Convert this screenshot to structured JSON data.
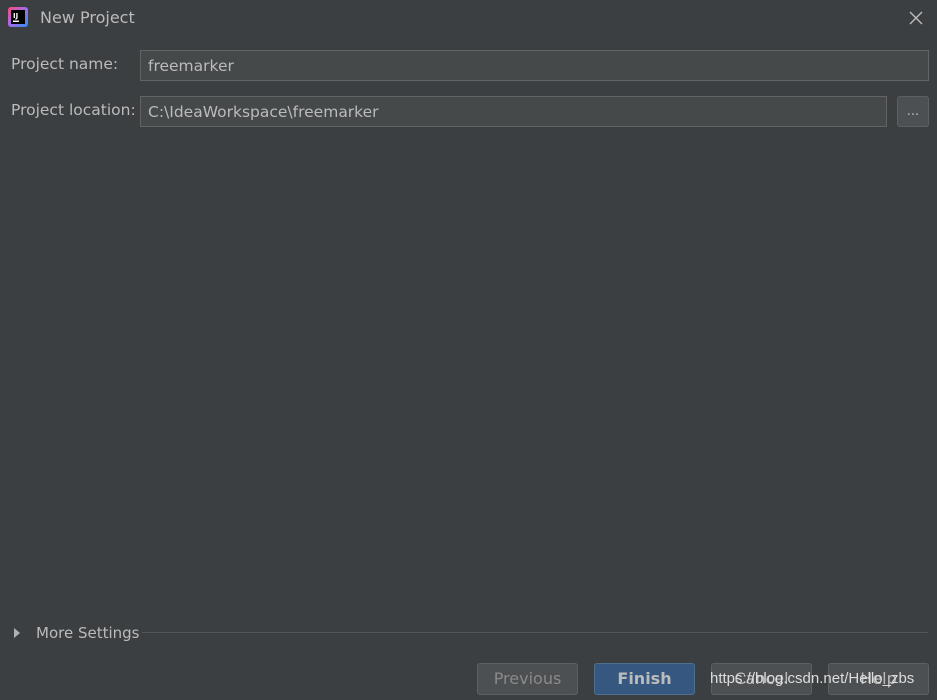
{
  "window": {
    "title": "New Project",
    "app_icon": "intellij-idea-icon",
    "close_icon": "close-icon"
  },
  "form": {
    "project_name_label": "Project name:",
    "project_name_value": "freemarker",
    "project_location_label": "Project location:",
    "project_location_value": "C:\\IdeaWorkspace\\freemarker",
    "browse_label": "..."
  },
  "more_settings": {
    "label": "More Settings",
    "expanded": false,
    "icon": "triangle-right-icon"
  },
  "footer": {
    "previous_label": "Previous",
    "finish_label": "Finish",
    "cancel_label": "Cancel",
    "help_label": "Help"
  },
  "watermark": "https://blog.csdn.net/Hello_zbs",
  "colors": {
    "background": "#3c3f41",
    "field_background": "#45494a",
    "primary_button": "#365880",
    "text": "#bbbbbb"
  }
}
